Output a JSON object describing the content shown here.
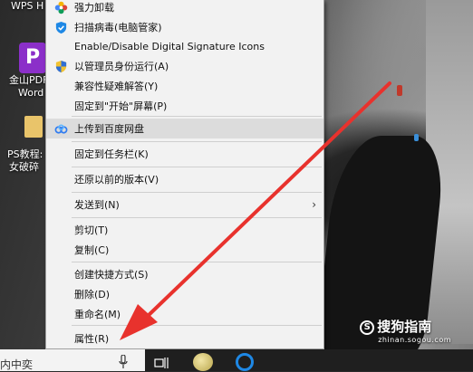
{
  "desktop": {
    "wps_title": "WPS H",
    "pdf_icon_glyph": "P",
    "pdf_label_line1": "金山PDF",
    "pdf_label_line2": "Word",
    "folder_label_line1": "PS教程:",
    "folder_label_line2": "女破碎"
  },
  "context_menu": {
    "items": [
      {
        "label": "强力卸载",
        "icon": "colorful-flower-icon"
      },
      {
        "label": "扫描病毒(电脑管家)",
        "icon": "shield-check-icon"
      },
      {
        "label": "Enable/Disable Digital Signature Icons",
        "icon": ""
      },
      {
        "label": "以管理员身份运行(A)",
        "icon": "uac-shield-icon"
      },
      {
        "label": "兼容性疑难解答(Y)",
        "icon": ""
      },
      {
        "label": "固定到\"开始\"屏幕(P)",
        "icon": ""
      },
      {
        "label": "上传到百度网盘",
        "icon": "baidu-cloud-icon",
        "highlighted": true
      },
      {
        "label": "固定到任务栏(K)",
        "icon": ""
      },
      {
        "label": "还原以前的版本(V)",
        "icon": ""
      },
      {
        "label": "发送到(N)",
        "icon": "",
        "submenu": true
      },
      {
        "label": "剪切(T)",
        "icon": ""
      },
      {
        "label": "复制(C)",
        "icon": ""
      },
      {
        "label": "创建快捷方式(S)",
        "icon": ""
      },
      {
        "label": "删除(D)",
        "icon": ""
      },
      {
        "label": "重命名(M)",
        "icon": ""
      },
      {
        "label": "属性(R)",
        "icon": ""
      }
    ],
    "submenu_arrow": "›",
    "highlight_color": "#dcdcdc"
  },
  "taskbar": {
    "search_text": "内中奕",
    "icons": [
      "microphone-icon",
      "task-view-icon",
      "app-icon",
      "browser-icon"
    ]
  },
  "watermark": {
    "main": "搜狗指南",
    "sub": "zhinan.sogou.com"
  },
  "annotation": {
    "arrow_color": "#e8322d"
  }
}
